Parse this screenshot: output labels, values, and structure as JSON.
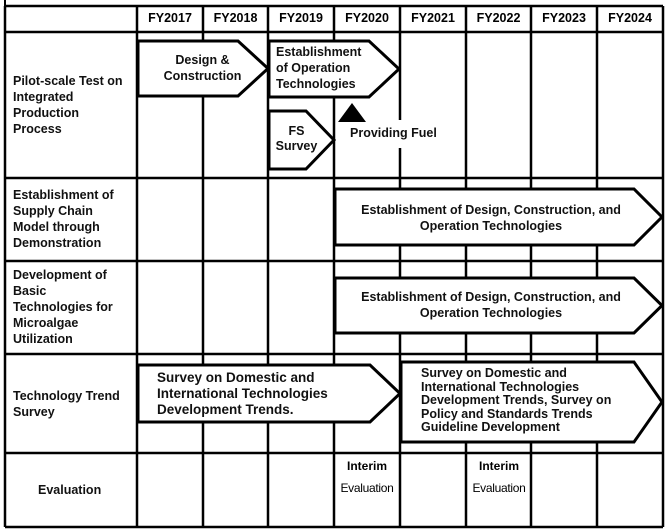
{
  "header": {
    "years": [
      "FY2017",
      "FY2018",
      "FY2019",
      "FY2020",
      "FY2021",
      "FY2022",
      "FY2023",
      "FY2024"
    ]
  },
  "rows": [
    {
      "label": "Pilot-scale Test on Integrated Production Process",
      "label_lines": [
        "Pilot-scale Test on",
        "Integrated",
        "Production",
        "Process"
      ],
      "items": [
        {
          "type": "arrow",
          "lines": [
            "Design &",
            "Construction"
          ],
          "start": "FY2017",
          "end": "FY2018"
        },
        {
          "type": "arrow",
          "lines": [
            "Establishment",
            "of Operation",
            "Technologies"
          ],
          "start": "FY2019",
          "end": "FY2020"
        },
        {
          "type": "arrow",
          "lines": [
            "FS",
            "Survey"
          ],
          "start": "FY2019",
          "end": "FY2019"
        },
        {
          "type": "milestone",
          "label": "Providing Fuel",
          "at": "FY2020",
          "marker": "triangle-up"
        }
      ]
    },
    {
      "label": "Establishment of Supply Chain Model through Demonstration",
      "label_lines": [
        "Establishment of",
        "Supply Chain",
        "Model through",
        "Demonstration"
      ],
      "items": [
        {
          "type": "arrow",
          "lines": [
            "Establishment of Design, Construction, and",
            "Operation Technologies"
          ],
          "start": "FY2020",
          "end": "FY2024"
        }
      ]
    },
    {
      "label": "Development of Basic Technologies for Microalgae Utilization",
      "label_lines": [
        "Development of",
        "Basic",
        "Technologies for",
        "Microalgae",
        "Utilization"
      ],
      "items": [
        {
          "type": "arrow",
          "lines": [
            "Establishment of Design, Construction, and",
            "Operation Technologies"
          ],
          "start": "FY2020",
          "end": "FY2024"
        }
      ]
    },
    {
      "label": "Technology Trend Survey",
      "label_lines": [
        "Technology Trend",
        "Survey"
      ],
      "items": [
        {
          "type": "arrow",
          "lines": [
            "Survey on Domestic and",
            "International Technologies",
            "Development Trends."
          ],
          "start": "FY2017",
          "end": "FY2020"
        },
        {
          "type": "arrow",
          "lines": [
            "Survey on Domestic and",
            "International Technologies",
            "Development Trends, Survey on",
            "Policy and Standards Trends",
            "Guideline Development"
          ],
          "start": "FY2021",
          "end": "FY2024"
        }
      ]
    },
    {
      "label": "Evaluation",
      "label_lines": [
        "Evaluation"
      ],
      "items": [
        {
          "type": "text",
          "lines": [
            "Interim",
            "Evaluation"
          ],
          "at": "FY2020"
        },
        {
          "type": "text",
          "lines": [
            "Interim",
            "Evaluation"
          ],
          "at": "FY2022"
        }
      ]
    }
  ],
  "colors": {
    "line": "#000000",
    "background": "#ffffff",
    "text": "#111111"
  }
}
